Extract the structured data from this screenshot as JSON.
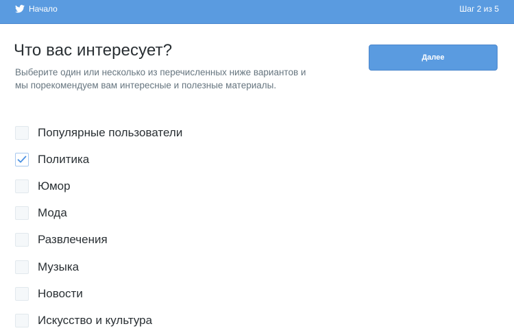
{
  "header": {
    "brand_label": "Начало",
    "step_label": "Шаг 2 из 5",
    "brand_icon": "twitter-bird-icon",
    "bar_color": "#5a9be0"
  },
  "main": {
    "title": "Что вас интересует?",
    "subtitle": "Выберите один или несколько из перечисленных ниже вариантов и мы порекомендуем вам интересные и полезные материалы.",
    "next_button": "Далее"
  },
  "options": [
    {
      "label": "Популярные пользователи",
      "checked": false
    },
    {
      "label": "Политика",
      "checked": true
    },
    {
      "label": "Юмор",
      "checked": false
    },
    {
      "label": "Мода",
      "checked": false
    },
    {
      "label": "Развлечения",
      "checked": false
    },
    {
      "label": "Музыка",
      "checked": false
    },
    {
      "label": "Новости",
      "checked": false
    },
    {
      "label": "Искусство и культура",
      "checked": false
    }
  ],
  "colors": {
    "accent": "#5a9be0",
    "check": "#4a90e2"
  }
}
